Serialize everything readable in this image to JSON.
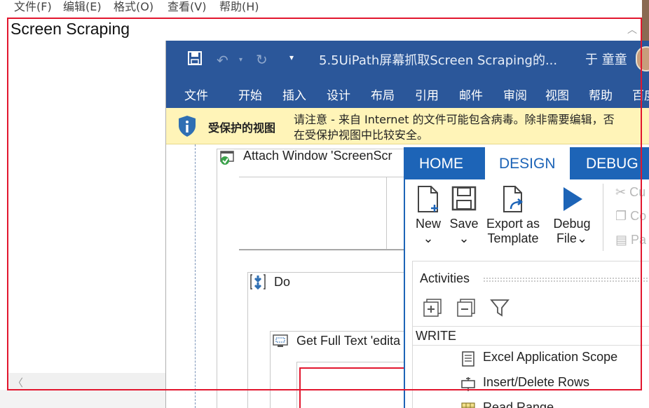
{
  "notepad": {
    "menu": [
      "文件(F)",
      "编辑(E)",
      "格式(O)",
      "查看(V)",
      "帮助(H)"
    ],
    "content": "Screen Scraping"
  },
  "word": {
    "title": "5.5UiPath屏幕抓取Screen Scraping的...",
    "user": "于 童童",
    "tabs": [
      "文件",
      "开始",
      "插入",
      "设计",
      "布局",
      "引用",
      "邮件",
      "审阅",
      "视图",
      "帮助",
      "百度"
    ],
    "protected": {
      "label": "受保护的视图",
      "line1": "请注意 - 来自 Internet 的文件可能包含病毒。除非需要编辑，否",
      "line2": "在受保护视图中比较安全。"
    },
    "workflow": {
      "attach": "Attach Window 'ScreenScr",
      "do": "Do",
      "get_full_text": "Get Full Text 'edita"
    }
  },
  "studio": {
    "tabs": [
      "HOME",
      "DESIGN",
      "DEBUG"
    ],
    "active_tab": "DESIGN",
    "ribbon": {
      "new": "New",
      "save": "Save",
      "export_l1": "Export as",
      "export_l2": "Template",
      "debug_l1": "Debug",
      "debug_l2": "File",
      "cut": "Cu",
      "copy": "Co",
      "paste": "Pa",
      "caret": "⌄"
    },
    "activities": {
      "header": "Activities",
      "group": "WRITE",
      "items": [
        "Excel Application Scope",
        "Insert/Delete Rows",
        "Read Range"
      ]
    }
  },
  "colors": {
    "word_blue": "#2b579a",
    "studio_blue": "#1d64b7",
    "protected_yellow": "#fff4b8",
    "highlight_red": "#e2162e"
  }
}
